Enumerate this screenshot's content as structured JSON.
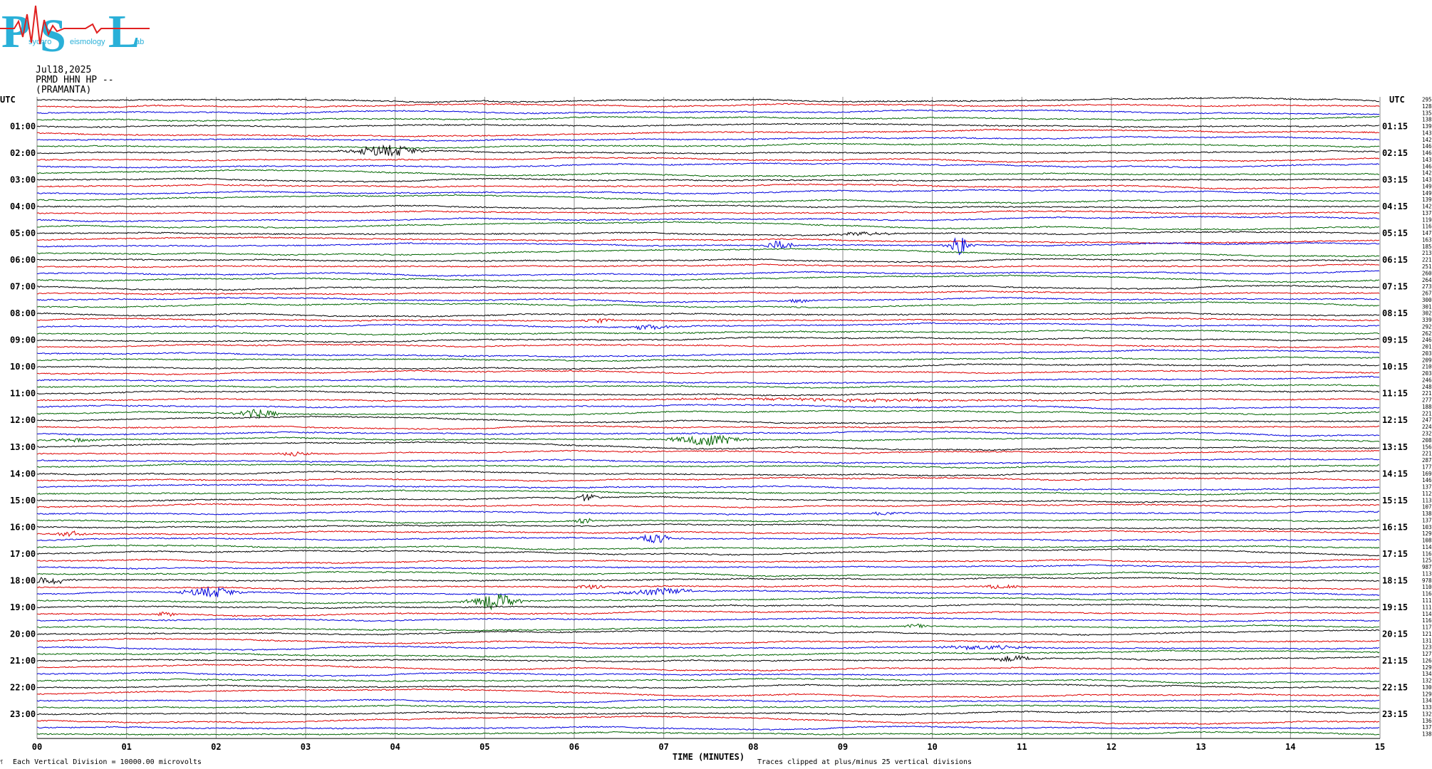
{
  "logo": {
    "text_p": "P",
    "text_s": "S",
    "text_l": "L",
    "small_1": "sychro",
    "small_2": "eismology",
    "small_3": "ab"
  },
  "header": {
    "date": "Jul18,2025",
    "station": "PRMD HHN HP --",
    "site": "(PRAMANTA)"
  },
  "footer": {
    "scale_note": "Each Vertical Division = 10000.00 microvolts",
    "clip_note": "Traces clipped at plus/minus 25 vertical divisions",
    "corner_mark": "⸮"
  },
  "chart_data": {
    "type": "line",
    "title": "",
    "xlabel": "TIME (MINUTES)",
    "ylabel": "",
    "xlim": [
      0,
      15
    ],
    "x_ticks": [
      "00",
      "01",
      "02",
      "03",
      "04",
      "05",
      "06",
      "07",
      "08",
      "09",
      "10",
      "11",
      "12",
      "13",
      "14",
      "15"
    ],
    "left_axis_header": "UTC",
    "right_axis_header": "UTC",
    "left_hour_labels": [
      "01:00",
      "02:00",
      "03:00",
      "04:00",
      "05:00",
      "06:00",
      "07:00",
      "08:00",
      "09:00",
      "10:00",
      "11:00",
      "12:00",
      "13:00",
      "14:00",
      "15:00",
      "16:00",
      "17:00",
      "18:00",
      "19:00",
      "20:00",
      "21:00",
      "22:00",
      "23:00"
    ],
    "right_hour_labels": [
      "01:15",
      "02:15",
      "03:15",
      "04:15",
      "05:15",
      "06:15",
      "07:15",
      "08:15",
      "09:15",
      "10:15",
      "11:15",
      "12:15",
      "13:15",
      "14:15",
      "15:15",
      "16:15",
      "17:15",
      "18:15",
      "19:15",
      "20:15",
      "21:15",
      "22:15",
      "23:15"
    ],
    "trace_colors": [
      "#000000",
      "#dd0000",
      "#0000dd",
      "#006400"
    ],
    "traces_count": 96,
    "trace_interval_minutes": 15,
    "grid": true,
    "right_values": [
      "2956",
      "1284",
      "1354",
      "1380",
      "1398",
      "1438",
      "1421",
      "1463",
      "1461",
      "1433",
      "1464",
      "1424",
      "1433",
      "1491",
      "1490",
      "1393",
      "1423",
      "1378",
      "1194",
      "1162",
      "1472",
      "1638",
      "1857",
      "2130",
      "2217",
      "2516",
      "2603",
      "2641",
      "2738",
      "2679",
      "3009",
      "3014",
      "3021",
      "3398",
      "2926",
      "2629",
      "2466",
      "2016",
      "2033",
      "2099",
      "2109",
      "2034",
      "2466",
      "2486",
      "2217",
      "2779",
      "1880",
      "2210",
      "2473",
      "2249",
      "2328",
      "2088",
      "1565",
      "2215",
      "2874",
      "1771",
      "1692",
      "1467",
      "1370",
      "1120",
      "1136",
      "1079",
      "1383",
      "1373",
      "1036",
      "1293",
      "1080",
      "1148",
      "1168",
      "1251",
      "987",
      "1131",
      "978",
      "1102",
      "1164",
      "1119",
      "1119",
      "1140",
      "1162",
      "1171",
      "1213",
      "1314",
      "1235",
      "1271",
      "1260",
      "1290",
      "1340",
      "1320",
      "1308",
      "1294",
      "1347",
      "1333",
      "1321",
      "1360",
      "1377",
      "1385"
    ],
    "events": [
      {
        "trace": 0,
        "minute": 5.0,
        "amp": 7,
        "width": 0.8,
        "kind": "slow"
      },
      {
        "trace": 1,
        "minute": 0.92,
        "amp": 10,
        "width": 1.2,
        "kind": "slow"
      },
      {
        "trace": 8,
        "minute": 3.9,
        "amp": 8,
        "width": 0.6,
        "kind": "burst"
      },
      {
        "trace": 22,
        "minute": 8.3,
        "amp": 7,
        "width": 0.25,
        "kind": "burst"
      },
      {
        "trace": 22,
        "minute": 10.3,
        "amp": 14,
        "width": 0.2,
        "kind": "burst"
      },
      {
        "trace": 20,
        "minute": 9.2,
        "amp": 3,
        "width": 0.5,
        "kind": "burst"
      },
      {
        "trace": 30,
        "minute": 8.5,
        "amp": 3,
        "width": 0.2,
        "kind": "burst"
      },
      {
        "trace": 33,
        "minute": 6.3,
        "amp": 3,
        "width": 0.3,
        "kind": "burst"
      },
      {
        "trace": 34,
        "minute": 6.85,
        "amp": 4,
        "width": 0.3,
        "kind": "burst"
      },
      {
        "trace": 45,
        "minute": 9.0,
        "amp": 2,
        "width": 3.0,
        "kind": "burst"
      },
      {
        "trace": 47,
        "minute": 2.45,
        "amp": 6,
        "width": 0.4,
        "kind": "burst"
      },
      {
        "trace": 51,
        "minute": 0.4,
        "amp": 3,
        "width": 0.4,
        "kind": "burst"
      },
      {
        "trace": 51,
        "minute": 7.5,
        "amp": 8,
        "width": 0.6,
        "kind": "burst"
      },
      {
        "trace": 53,
        "minute": 2.9,
        "amp": 3,
        "width": 0.3,
        "kind": "burst"
      },
      {
        "trace": 60,
        "minute": 6.15,
        "amp": 6,
        "width": 0.2,
        "kind": "burst"
      },
      {
        "trace": 63,
        "minute": 6.1,
        "amp": 4,
        "width": 0.2,
        "kind": "burst"
      },
      {
        "trace": 62,
        "minute": 9.5,
        "amp": 2,
        "width": 0.4,
        "kind": "burst"
      },
      {
        "trace": 65,
        "minute": 0.35,
        "amp": 4,
        "width": 0.3,
        "kind": "burst"
      },
      {
        "trace": 66,
        "minute": 6.9,
        "amp": 7,
        "width": 0.3,
        "kind": "burst"
      },
      {
        "trace": 72,
        "minute": 0.15,
        "amp": 5,
        "width": 0.4,
        "kind": "burst"
      },
      {
        "trace": 74,
        "minute": 1.95,
        "amp": 7,
        "width": 0.5,
        "kind": "burst"
      },
      {
        "trace": 73,
        "minute": 6.2,
        "amp": 3,
        "width": 0.3,
        "kind": "burst"
      },
      {
        "trace": 74,
        "minute": 6.95,
        "amp": 5,
        "width": 0.6,
        "kind": "burst"
      },
      {
        "trace": 75,
        "minute": 5.1,
        "amp": 12,
        "width": 0.4,
        "kind": "burst"
      },
      {
        "trace": 73,
        "minute": 10.8,
        "amp": 3,
        "width": 0.4,
        "kind": "burst"
      },
      {
        "trace": 77,
        "minute": 1.45,
        "amp": 3,
        "width": 0.2,
        "kind": "burst"
      },
      {
        "trace": 79,
        "minute": 9.8,
        "amp": 3,
        "width": 0.2,
        "kind": "burst"
      },
      {
        "trace": 82,
        "minute": 10.6,
        "amp": 3,
        "width": 0.8,
        "kind": "burst"
      },
      {
        "trace": 84,
        "minute": 10.9,
        "amp": 4,
        "width": 0.5,
        "kind": "burst"
      }
    ]
  }
}
